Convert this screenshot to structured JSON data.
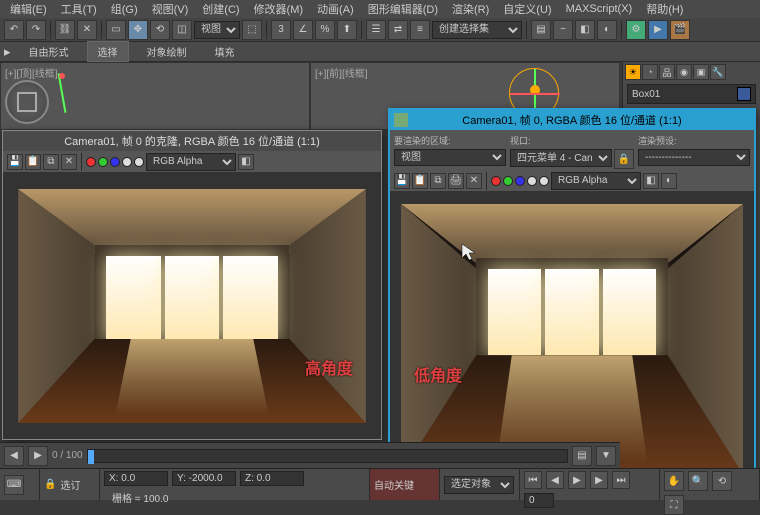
{
  "menu": {
    "items": [
      "编辑(E)",
      "工具(T)",
      "组(G)",
      "视图(V)",
      "创建(C)",
      "修改器(M)",
      "动画(A)",
      "图形编辑器(D)",
      "渲染(R)",
      "自定义(U)",
      "MAXScript(X)",
      "帮助(H)"
    ]
  },
  "toolbar": {
    "select_label": "视图",
    "set_label": "创建选择集"
  },
  "ribbon": {
    "tabs": [
      "自由形式",
      "选择",
      "对象绘制",
      "填充"
    ]
  },
  "viewports": {
    "left_label": "[+][顶][线框]",
    "right_label": "[+][前][线框]"
  },
  "side": {
    "object": "Box01"
  },
  "render1": {
    "title": "Camera01, 帧 0 的克隆, RGBA 颜色 16 位/通道 (1:1)",
    "channel": "RGB Alpha",
    "annotation": "高角度"
  },
  "render2": {
    "title": "Camera01, 帧 0, RGBA 颜色 16 位/通道 (1:1)",
    "area_label": "要渲染的区域:",
    "area_value": "视图",
    "viewport_label": "视口:",
    "viewport_value": "四元菜单 4 - Can",
    "preset_label": "渲染预设:",
    "preset_value": "--------------",
    "channel": "RGB Alpha",
    "annotation": "低角度"
  },
  "timeline": {
    "range": "0 / 100"
  },
  "status": {
    "sel_label": "选订",
    "x": "X: 0.0",
    "y": "Y: -2000.0",
    "z": "Z: 0.0",
    "grid": "栅格 = 100.0",
    "autokey": "自动关键",
    "selset": "选定对象",
    "frame": "0"
  }
}
